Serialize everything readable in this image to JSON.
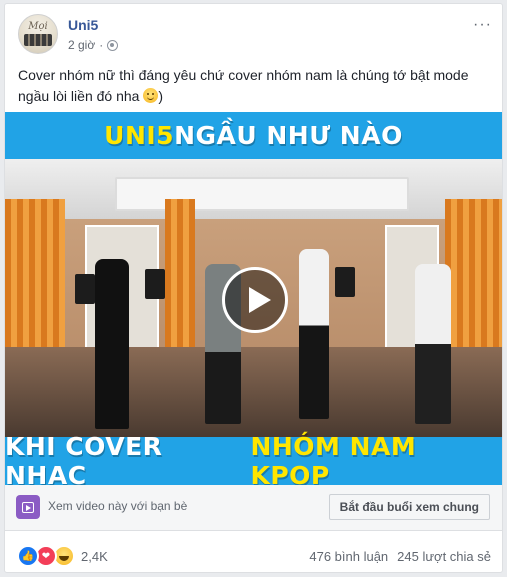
{
  "post": {
    "page_name": "Uni5",
    "avatar_text": "Mọi",
    "time": "2 giờ",
    "more": "···",
    "caption": "Cover nhóm nữ thì đáng yêu chứ cover nhóm nam là chúng tớ bật mode ngầu lòi liền đó nha",
    "caption_end": ")"
  },
  "video": {
    "top_title_part1": "UNI5",
    "top_title_part2": " NGẦU NHƯ NÀO",
    "bottom_title_part1": "KHI COVER NHẠC ",
    "bottom_title_part2": "NHÓM NAM KPOP",
    "colors": {
      "banner": "#21a3e6",
      "highlight": "#ffe600",
      "text": "#ffffff"
    }
  },
  "watch_party": {
    "text": "Xem video này với bạn bè",
    "button": "Bắt đầu buổi xem chung"
  },
  "stats": {
    "reactions": "2,4K",
    "comments": "476 bình luận",
    "shares": "245 lượt chia sẻ"
  }
}
